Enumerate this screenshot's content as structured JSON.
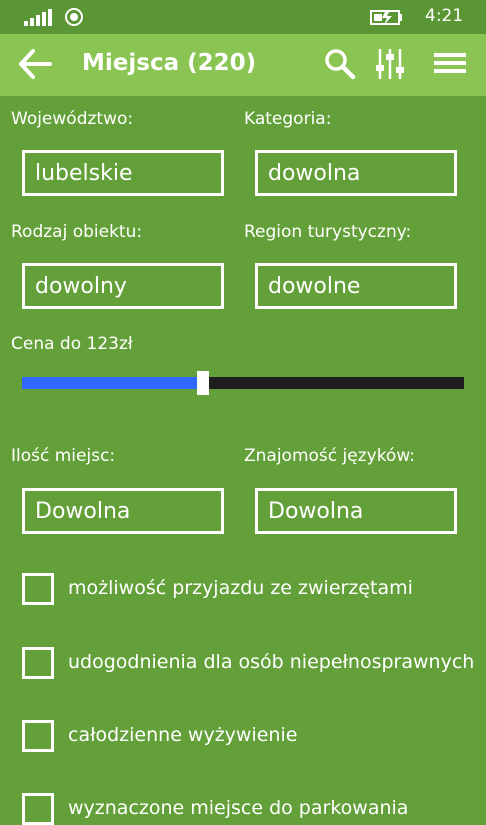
{
  "status": {
    "time": "4:21"
  },
  "header": {
    "title": "Miejsca (220)"
  },
  "icons": {
    "back": "arrow-left",
    "search": "magnifier",
    "filters": "sliders",
    "menu": "hamburger"
  },
  "form": {
    "wojewodztwo": {
      "label": "Województwo:",
      "value": "lubelskie"
    },
    "kategoria": {
      "label": "Kategoria:",
      "value": "dowolna"
    },
    "rodzaj": {
      "label": "Rodzaj obiektu:",
      "value": "dowolny"
    },
    "region": {
      "label": "Region turystyczny:",
      "value": "dowolne"
    },
    "cena": {
      "label": "Cena do 123zł",
      "fraction": 0.41
    },
    "ilosc": {
      "label": "Ilość miejsc:",
      "value": "Dowolna"
    },
    "jezyki": {
      "label": "Znajomość języków:",
      "value": "Dowolna"
    }
  },
  "checkboxes": [
    {
      "label": "możliwość przyjazdu ze zwierzętami",
      "checked": false
    },
    {
      "label": "udogodnienia dla osób niepełnosprawnych",
      "checked": false
    },
    {
      "label": "całodzienne wyżywienie",
      "checked": false
    },
    {
      "label": "wyznaczone miejsce do parkowania",
      "checked": false
    }
  ],
  "colors": {
    "background": "#64a03a",
    "app_bar": "#8ac452",
    "slider_fill": "#2f67ff",
    "slider_track": "#1e1e1e"
  }
}
